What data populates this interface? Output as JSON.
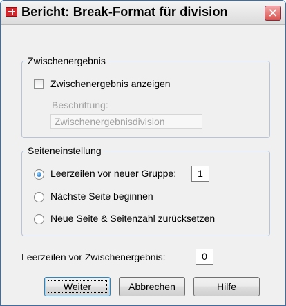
{
  "window": {
    "title": "Bericht: Break-Format für division",
    "app_icon": "spss-table-icon",
    "close_icon": "close-icon"
  },
  "subtotal_group": {
    "legend": "Zwischenergebnis",
    "show_checkbox": {
      "label": "Zwischenergebnis anzeigen",
      "checked": false
    },
    "caption_label": "Beschriftung:",
    "caption_value": "Zwischenergebnisdivision"
  },
  "page_group": {
    "legend": "Seiteneinstellung",
    "options": [
      {
        "label": "Leerzeilen vor neuer Gruppe:",
        "checked": true
      },
      {
        "label": "Nächste Seite beginnen",
        "checked": false
      },
      {
        "label": "Neue Seite & Seitenzahl zurücksetzen",
        "checked": false
      }
    ],
    "blank_lines_value": "1"
  },
  "blank_before_subtotal": {
    "label": "Leerzeilen vor Zwischenergebnis:",
    "value": "0"
  },
  "buttons": {
    "continue": "Weiter",
    "cancel": "Abbrechen",
    "help": "Hilfe"
  }
}
